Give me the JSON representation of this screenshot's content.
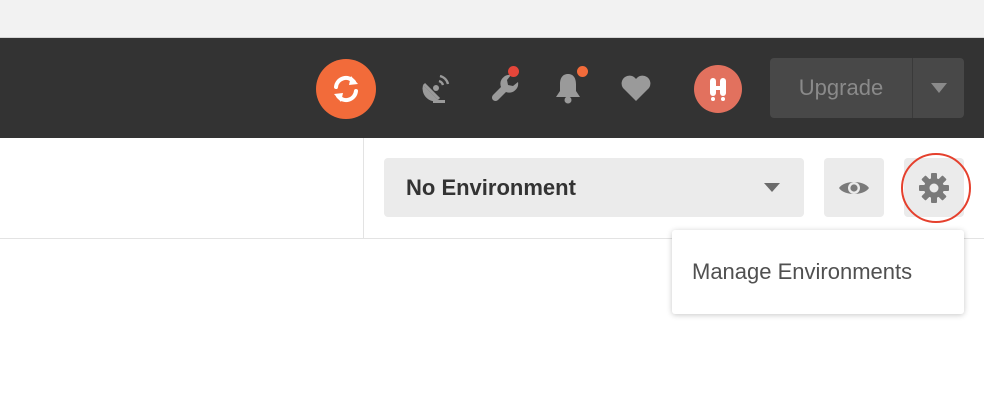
{
  "header": {
    "upgrade_label": "Upgrade",
    "colors": {
      "background": "#333333",
      "sync_button": "#f26b3a",
      "avatar": "#e2715e",
      "wrench_badge": "#e5463a",
      "bell_badge": "#f26b3a"
    },
    "icons": [
      "sync-icon",
      "satellite-dish-icon",
      "wrench-icon",
      "bell-icon",
      "heart-icon",
      "avatar-icon",
      "chevron-down-icon"
    ]
  },
  "toolbar": {
    "environment_selected": "No Environment",
    "icons": [
      "eye-icon",
      "gear-icon"
    ]
  },
  "dropdown": {
    "items": [
      "Manage Environments"
    ]
  }
}
